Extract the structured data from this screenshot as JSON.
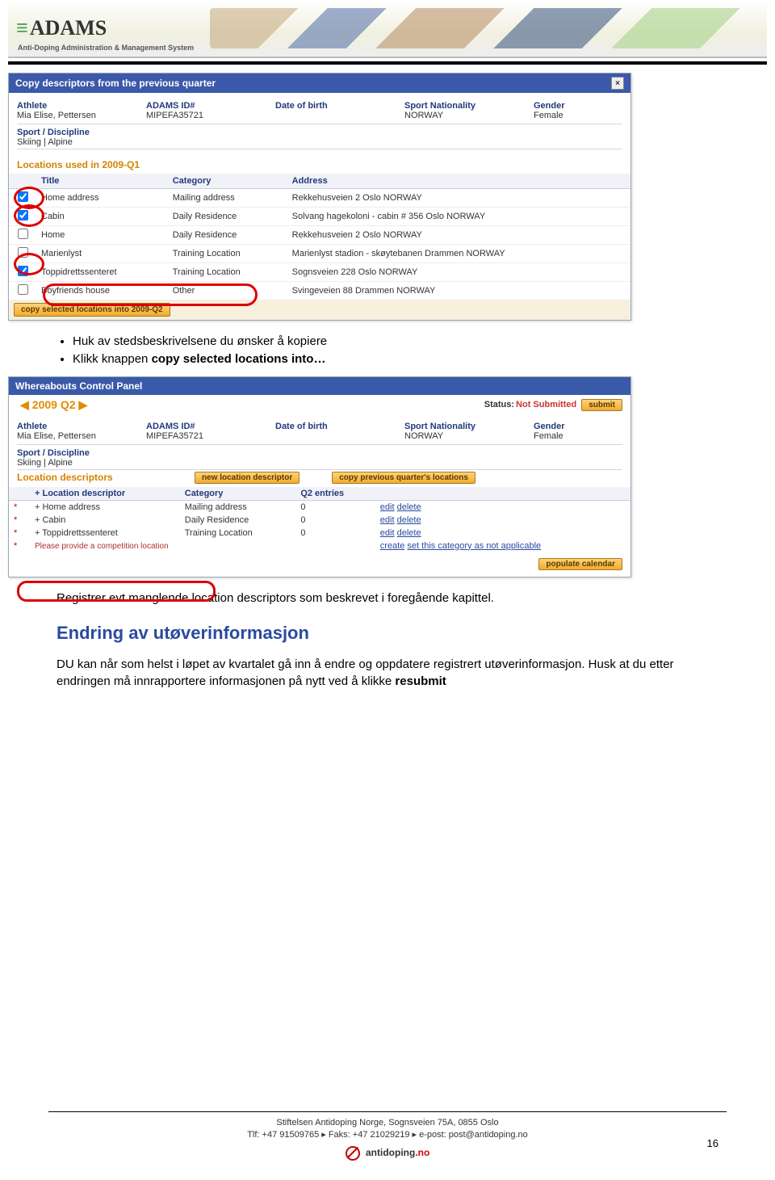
{
  "banner": {
    "logo_text": "ADAMS",
    "tagline": "Anti-Doping Administration & Management System"
  },
  "panel1": {
    "title": "Copy descriptors from the previous quarter",
    "athlete": {
      "labels": {
        "athlete": "Athlete",
        "adams": "ADAMS ID#",
        "dob": "Date of birth",
        "nat": "Sport Nationality",
        "gender": "Gender",
        "sport": "Sport / Discipline"
      },
      "name": "Mia Elise, Pettersen",
      "adams_id": "MIPEFA35721",
      "dob": "",
      "nationality": "NORWAY",
      "gender": "Female",
      "sport": "Skiing | Alpine"
    },
    "section_title": "Locations used in 2009-Q1",
    "table": {
      "headers": {
        "title": "Title",
        "category": "Category",
        "address": "Address"
      },
      "rows": [
        {
          "checked": true,
          "title": "Home address",
          "category": "Mailing address",
          "address": "Rekkehusveien 2 Oslo NORWAY"
        },
        {
          "checked": true,
          "title": "Cabin",
          "category": "Daily Residence",
          "address": "Solvang hagekoloni - cabin # 356 Oslo NORWAY"
        },
        {
          "checked": false,
          "title": "Home",
          "category": "Daily Residence",
          "address": "Rekkehusveien 2 Oslo NORWAY"
        },
        {
          "checked": false,
          "title": "Marienlyst",
          "category": "Training Location",
          "address": "Marienlyst stadion - skøytebanen Drammen NORWAY"
        },
        {
          "checked": true,
          "title": "Toppidrettssenteret",
          "category": "Training Location",
          "address": "Sognsveien 228 Oslo NORWAY"
        },
        {
          "checked": false,
          "title": "Boyfriends house",
          "category": "Other",
          "address": "Svingeveien 88 Drammen NORWAY"
        }
      ],
      "copy_button": "copy selected locations into 2009-Q2"
    }
  },
  "list1": {
    "item1_a": "Huk av stedsbeskrivelsene du ønsker å kopiere",
    "item2_a": "Klikk knappen ",
    "item2_b": "copy selected locations into…"
  },
  "panel2": {
    "title": "Whereabouts Control Panel",
    "quarter": "2009 Q2",
    "status_label": "Status:",
    "status_value": "Not Submitted",
    "submit_btn": "submit",
    "athlete": {
      "labels": {
        "athlete": "Athlete",
        "adams": "ADAMS ID#",
        "dob": "Date of birth",
        "nat": "Sport Nationality",
        "gender": "Gender",
        "sport": "Sport / Discipline"
      },
      "name": "Mia Elise, Pettersen",
      "adams_id": "MIPEFA35721",
      "dob": "",
      "nationality": "NORWAY",
      "gender": "Female",
      "sport": "Skiing | Alpine"
    },
    "desc_section_title": "Location descriptors",
    "btn_new": "new location descriptor",
    "btn_copy_prev": "copy previous quarter's locations",
    "table": {
      "headers": {
        "desc": "+ Location descriptor",
        "category": "Category",
        "entries": "Q2 entries",
        "actions": ""
      },
      "rows": [
        {
          "name": "+ Home address",
          "category": "Mailing address",
          "entries": "0",
          "edit": "edit",
          "del": "delete"
        },
        {
          "name": "+ Cabin",
          "category": "Daily Residence",
          "entries": "0",
          "edit": "edit",
          "del": "delete"
        },
        {
          "name": "+ Toppidrettssenteret",
          "category": "Training Location",
          "entries": "0",
          "edit": "edit",
          "del": "delete"
        }
      ],
      "warning": "Please provide a competition location",
      "create_link": "create",
      "set_na_link": "set this category as not applicable",
      "populate_btn": "populate calendar"
    }
  },
  "para1": "Registrer evt manglende location descriptors som beskrevet i foregående kapittel.",
  "heading2": "Endring av utøverinformasjon",
  "para2_a": "DU kan når som helst i løpet av kvartalet gå inn å endre og oppdatere registrert utøverinformasjon. Husk at du etter endringen må innrapportere informasjonen på nytt ved å klikke ",
  "para2_b": "resubmit",
  "footer": {
    "line1": "Stiftelsen Antidoping Norge, Sognsveien 75A, 0855 Oslo",
    "line2": "Tlf: +47 91509765 ▸ Faks: +47 21029219 ▸ e-post: post@antidoping.no",
    "page": "16",
    "logo_text": "antidoping",
    "logo_suffix": ".no"
  }
}
